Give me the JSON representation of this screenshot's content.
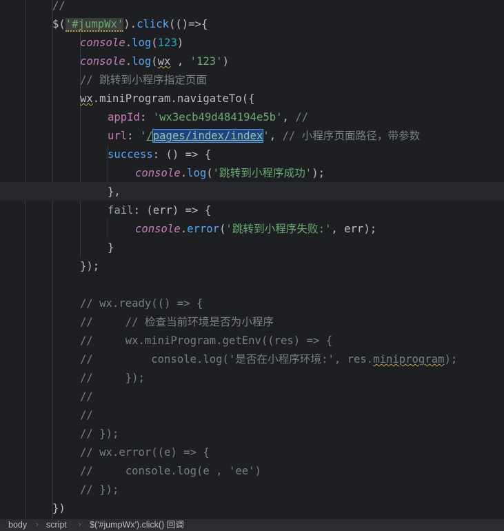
{
  "editor": {
    "lines": [
      {
        "id": "l1",
        "indent": 2,
        "tokens": [
          {
            "k": "comment",
            "t": "//"
          }
        ]
      },
      {
        "id": "l2",
        "indent": 2,
        "tokens": [
          {
            "k": "plain",
            "t": "$("
          },
          {
            "k": "str-hl",
            "t": "'#jumpWx'"
          },
          {
            "k": "plain",
            "t": ")."
          },
          {
            "k": "fn",
            "t": "click"
          },
          {
            "k": "plain",
            "t": "(()=>{"
          }
        ]
      },
      {
        "id": "l3",
        "indent": 3,
        "tokens": [
          {
            "k": "global",
            "t": "console"
          },
          {
            "k": "plain",
            "t": "."
          },
          {
            "k": "fn",
            "t": "log"
          },
          {
            "k": "plain",
            "t": "("
          },
          {
            "k": "num",
            "t": "123"
          },
          {
            "k": "plain",
            "t": ")"
          }
        ]
      },
      {
        "id": "l4",
        "indent": 3,
        "tokens": [
          {
            "k": "global",
            "t": "console"
          },
          {
            "k": "plain",
            "t": "."
          },
          {
            "k": "fn",
            "t": "log"
          },
          {
            "k": "plain",
            "t": "("
          },
          {
            "k": "warn",
            "t": "wx"
          },
          {
            "k": "plain",
            "t": " , "
          },
          {
            "k": "str",
            "t": "'123'"
          },
          {
            "k": "plain",
            "t": ")"
          }
        ]
      },
      {
        "id": "l5",
        "indent": 3,
        "tokens": [
          {
            "k": "comment",
            "t": "// 跳转到小程序指定页面"
          }
        ]
      },
      {
        "id": "l6",
        "indent": 3,
        "tokens": [
          {
            "k": "warn",
            "t": "wx"
          },
          {
            "k": "plain",
            "t": ".miniProgram.navigateTo({"
          }
        ]
      },
      {
        "id": "l7",
        "indent": 4,
        "tokens": [
          {
            "k": "key",
            "t": "appId"
          },
          {
            "k": "plain",
            "t": ": "
          },
          {
            "k": "str",
            "t": "'wx3ecb49d484194e5b'"
          },
          {
            "k": "plain",
            "t": ", "
          },
          {
            "k": "comment",
            "t": "//"
          }
        ]
      },
      {
        "id": "l8",
        "indent": 4,
        "tokens": [
          {
            "k": "key",
            "t": "url"
          },
          {
            "k": "plain",
            "t": ": "
          },
          {
            "k": "str",
            "t": "'"
          },
          {
            "k": "link",
            "t": "/"
          },
          {
            "k": "sel",
            "t": "pages/index/index"
          },
          {
            "k": "str",
            "t": "'"
          },
          {
            "k": "plain",
            "t": ", "
          },
          {
            "k": "comment",
            "t": "// 小程序页面路径，带参数"
          }
        ]
      },
      {
        "id": "l9",
        "indent": 4,
        "tokens": [
          {
            "k": "fn",
            "t": "success"
          },
          {
            "k": "plain",
            "t": ": () => {"
          }
        ]
      },
      {
        "id": "l10",
        "indent": 5,
        "tokens": [
          {
            "k": "global",
            "t": "console"
          },
          {
            "k": "plain",
            "t": "."
          },
          {
            "k": "fn",
            "t": "log"
          },
          {
            "k": "plain",
            "t": "("
          },
          {
            "k": "str",
            "t": "'跳转到小程序成功'"
          },
          {
            "k": "plain",
            "t": ");"
          }
        ]
      },
      {
        "id": "l11",
        "indent": 4,
        "tokens": [
          {
            "k": "plain",
            "t": "},"
          }
        ]
      },
      {
        "id": "l12",
        "indent": 4,
        "tokens": [
          {
            "k": "fail",
            "t": "fail"
          },
          {
            "k": "plain",
            "t": ": (err) => {"
          }
        ]
      },
      {
        "id": "l13",
        "indent": 5,
        "tokens": [
          {
            "k": "global",
            "t": "console"
          },
          {
            "k": "plain",
            "t": "."
          },
          {
            "k": "fn",
            "t": "error"
          },
          {
            "k": "plain",
            "t": "("
          },
          {
            "k": "str",
            "t": "'跳转到小程序失败:'"
          },
          {
            "k": "plain",
            "t": ", err);"
          }
        ]
      },
      {
        "id": "l14",
        "indent": 4,
        "tokens": [
          {
            "k": "plain",
            "t": "}"
          }
        ]
      },
      {
        "id": "l15",
        "indent": 3,
        "tokens": [
          {
            "k": "plain",
            "t": "});"
          }
        ]
      },
      {
        "id": "l16",
        "indent": 3,
        "tokens": []
      },
      {
        "id": "l17",
        "indent": 3,
        "tokens": [
          {
            "k": "comment",
            "t": "// wx.ready(() => {"
          }
        ]
      },
      {
        "id": "l18",
        "indent": 3,
        "tokens": [
          {
            "k": "comment",
            "t": "//     // 检查当前环境是否为小程序"
          }
        ]
      },
      {
        "id": "l19",
        "indent": 3,
        "tokens": [
          {
            "k": "comment",
            "t": "//     wx.miniProgram.getEnv((res) => {"
          }
        ]
      },
      {
        "id": "l20",
        "indent": 3,
        "tokens": [
          {
            "k": "comment",
            "t": "//         console.log('是否在小程序环境:', res."
          },
          {
            "k": "comment-warn",
            "t": "miniprogram"
          },
          {
            "k": "comment",
            "t": ");"
          }
        ]
      },
      {
        "id": "l21",
        "indent": 3,
        "tokens": [
          {
            "k": "comment",
            "t": "//     });"
          }
        ]
      },
      {
        "id": "l22",
        "indent": 3,
        "tokens": [
          {
            "k": "comment",
            "t": "//"
          }
        ]
      },
      {
        "id": "l23",
        "indent": 3,
        "tokens": [
          {
            "k": "comment",
            "t": "//"
          }
        ]
      },
      {
        "id": "l24",
        "indent": 3,
        "tokens": [
          {
            "k": "comment",
            "t": "// });"
          }
        ]
      },
      {
        "id": "l25",
        "indent": 3,
        "tokens": [
          {
            "k": "comment",
            "t": "// wx.error((e) => {"
          }
        ]
      },
      {
        "id": "l26",
        "indent": 3,
        "tokens": [
          {
            "k": "comment",
            "t": "//     console.log(e , 'ee')"
          }
        ]
      },
      {
        "id": "l27",
        "indent": 3,
        "tokens": [
          {
            "k": "comment",
            "t": "// });"
          }
        ]
      },
      {
        "id": "l28",
        "indent": 2,
        "tokens": [
          {
            "k": "plain",
            "t": "})"
          }
        ]
      }
    ],
    "current_line": "l11"
  },
  "breadcrumb": {
    "items": [
      {
        "label": "body"
      },
      {
        "label": "script"
      },
      {
        "label": "$('#jumpWx').click() 回调"
      }
    ]
  },
  "colors": {
    "background": "#1e1f22",
    "string": "#6aab73",
    "number": "#2aacb8",
    "keyword_property": "#c77dbb",
    "function": "#56a8f5",
    "comment": "#7a7e85",
    "text": "#bcbec4"
  }
}
